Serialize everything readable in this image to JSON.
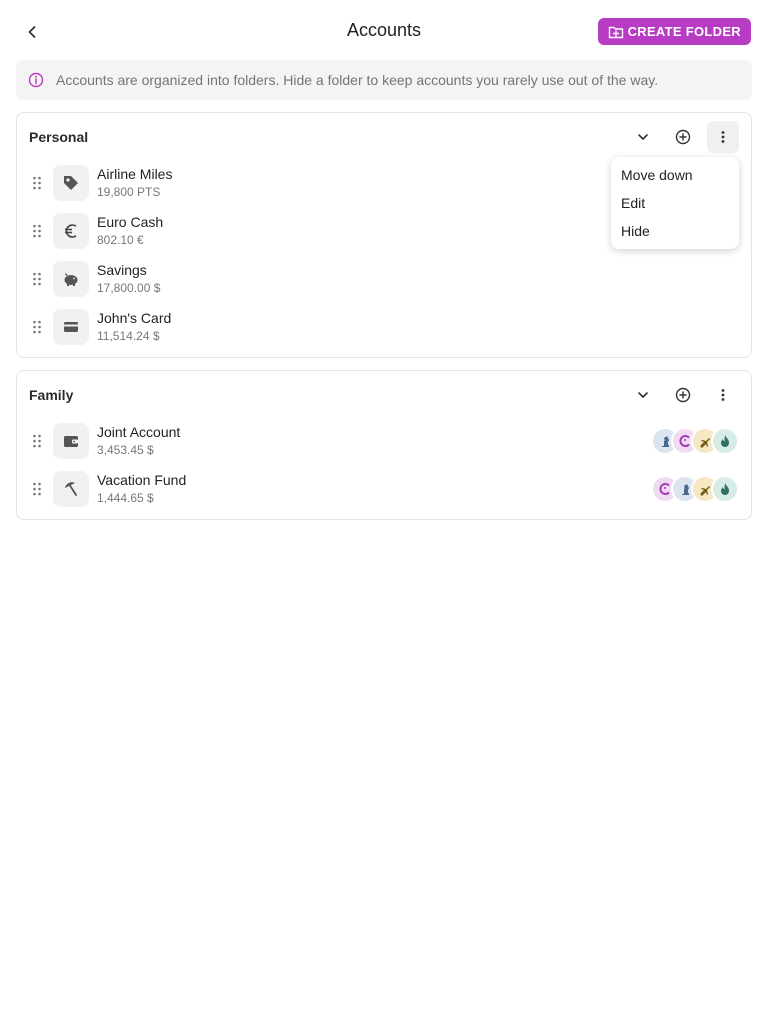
{
  "header": {
    "title": "Accounts",
    "create_folder_label": "CREATE FOLDER"
  },
  "info": {
    "text": "Accounts are organized into folders. Hide a folder to keep accounts you rarely use out of the way."
  },
  "colors": {
    "accent": "#b83bc4",
    "banner_bg": "#f4f4f4"
  },
  "folders": [
    {
      "name": "Personal",
      "accounts": [
        {
          "name": "Airline Miles",
          "balance": "19,800 PTS",
          "icon": "tag-icon"
        },
        {
          "name": "Euro Cash",
          "balance": "802.10 €",
          "icon": "euro-icon"
        },
        {
          "name": "Savings",
          "balance": "17,800.00 $",
          "icon": "piggy-bank-icon"
        },
        {
          "name": "John's Card",
          "balance": "11,514.24 $",
          "icon": "credit-card-icon"
        }
      ]
    },
    {
      "name": "Family",
      "accounts": [
        {
          "name": "Joint Account",
          "balance": "3,453.45 $",
          "icon": "wallet-icon",
          "members": [
            "chess-piece-avatar",
            "smile-avatar",
            "plane-avatar",
            "flame-avatar"
          ]
        },
        {
          "name": "Vacation Fund",
          "balance": "1,444.65 $",
          "icon": "beach-umbrella-icon",
          "members": [
            "smile-avatar",
            "chess-piece-avatar",
            "plane-avatar",
            "flame-avatar"
          ]
        }
      ]
    }
  ],
  "menu": {
    "items": [
      "Move down",
      "Edit",
      "Hide"
    ]
  }
}
